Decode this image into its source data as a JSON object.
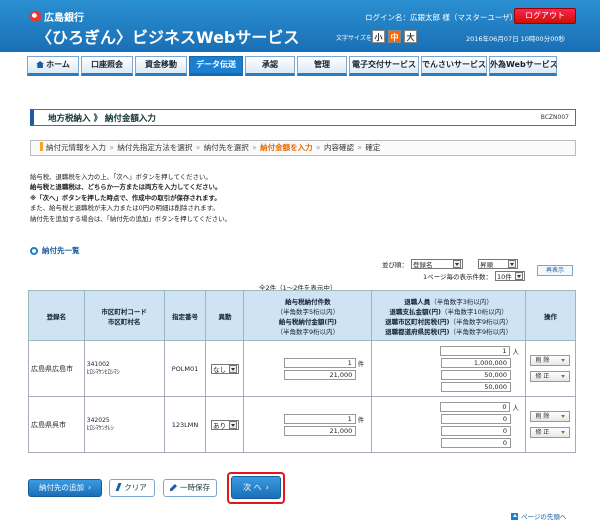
{
  "header": {
    "bank_name": "広島銀行",
    "service_name": "〈ひろぎん〉ビジネスWebサービス",
    "login_text": "ログイン名：広銀太郎 様（マスターユーザ）",
    "logout_label": "ログアウト",
    "font_size_label": "文字サイズを変更",
    "font_small": "小",
    "font_medium": "中",
    "font_large": "大",
    "datetime": "2016年06月07日 10時00分00秒"
  },
  "nav": [
    {
      "label": "ホーム",
      "active": false
    },
    {
      "label": "口座照会",
      "active": false
    },
    {
      "label": "資金移動",
      "active": false
    },
    {
      "label": "データ伝送",
      "active": true
    },
    {
      "label": "承認",
      "active": false
    },
    {
      "label": "管理",
      "active": false
    },
    {
      "label": "電子交付サービス",
      "active": false
    },
    {
      "label": "でんさいサービス",
      "active": false
    },
    {
      "label": "外為Webサービス",
      "active": false
    }
  ],
  "title": {
    "text": "地方税納入 》 納付金額入力",
    "screen_id": "BCZN007"
  },
  "steps": {
    "s1": "納付元情報を入力",
    "s2": "納付先指定方法を選択",
    "s3": "納付先を選択",
    "s4": "納付金額を入力",
    "s5": "内容確認",
    "s6": "確定",
    "sep": "»"
  },
  "instructions": {
    "l1": "給与税、退職税を入力の上、「次へ」ボタンを押してください。",
    "l2": "給与税と退職税は、どちらか一方または両方を入力してください。",
    "l3": "※「次へ」ボタンを押した時点で、作成中の取引が保存されます。",
    "l4": "また、給与税と退職税が未入力または0円の明細は削除されます。",
    "l5": "納付先を追加する場合は、「納付先の追加」ボタンを押してください。"
  },
  "section_title": "納付先一覧",
  "sort": {
    "label": "並び順：",
    "key": "登録名",
    "order": "昇順",
    "perpage_label": "1ページ毎の表示件数：",
    "perpage": "10件",
    "relist_label": "再表示"
  },
  "count_text": "全2件（1～2件を表示中）",
  "table": {
    "headers": {
      "name": "登録名",
      "code_l1": "市区町村コード",
      "code_l2": "市区町村名",
      "id": "指定番号",
      "status": "異動",
      "tax_l1": "給与税納付件数",
      "tax_l1s": "（半角数字5桁以内）",
      "tax_l2": "給与税納付金額(円)",
      "tax_l2s": "（半角数字9桁以内）",
      "ret_l1": "退職人員",
      "ret_l1s": "（半角数字3桁以内）",
      "ret_l2": "退職支払金額(円)",
      "ret_l2s": "（半角数字10桁以内）",
      "ret_l3": "退職市区町村民税(円)",
      "ret_l3s": "（半角数字9桁以内）",
      "ret_l4": "退職都道府県民税(円)",
      "ret_l4s": "（半角数字9桁以内）",
      "op": "操作"
    },
    "rows": [
      {
        "name": "広島県広島市",
        "code": "341002",
        "muni_kana": "ﾋﾛｼﾏｹﾝﾋﾛｼﾏｼ",
        "id": "POLM01",
        "status": "なし",
        "tax_count": "1",
        "tax_amount": "21,000",
        "ret_persons": "1",
        "ret_pay": "1,000,000",
        "ret_city": "50,000",
        "ret_pref": "50,000"
      },
      {
        "name": "広島県呉市",
        "code": "342025",
        "muni_kana": "ﾋﾛｼﾏｹﾝｸﾚｼ",
        "id": "123LMN",
        "status": "あり",
        "tax_count": "1",
        "tax_amount": "21,000",
        "ret_persons": "0",
        "ret_pay": "0",
        "ret_city": "0",
        "ret_pref": "0"
      }
    ],
    "unit_ken": "件",
    "unit_nin": "人",
    "delete_label": "削 除",
    "edit_label": "修 正"
  },
  "buttons": {
    "add": "納付先の追加",
    "clear": "クリア",
    "save": "一時保存",
    "next": "次 へ"
  },
  "totop": "ページの先頭へ"
}
